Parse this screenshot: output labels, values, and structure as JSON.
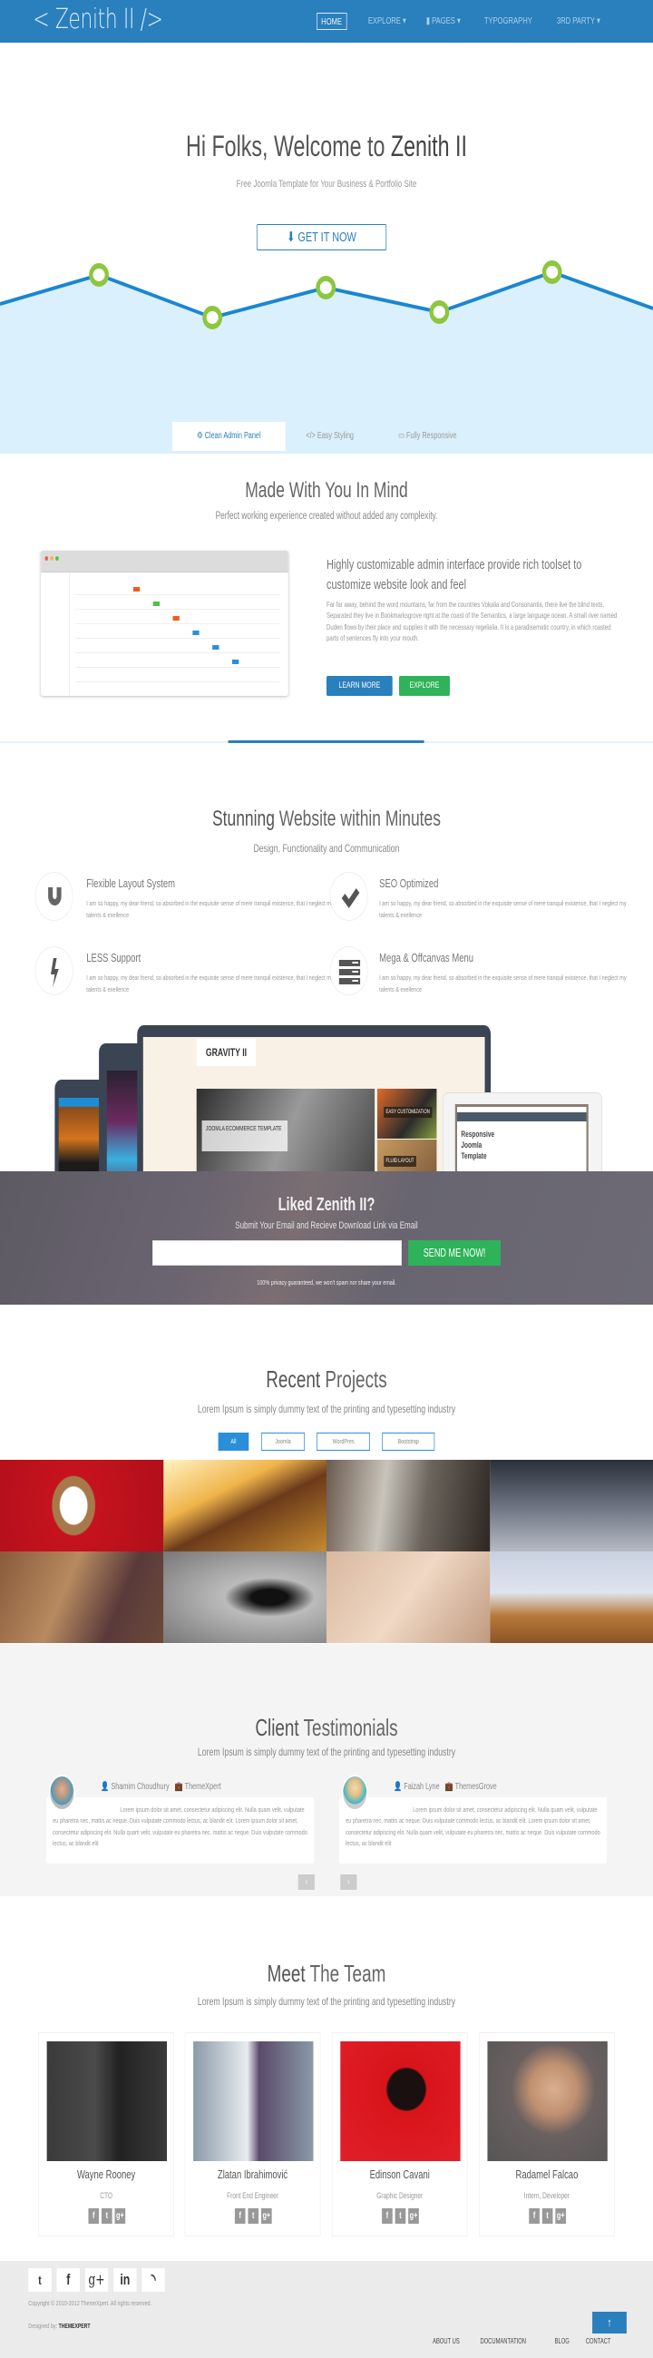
{
  "nav": {
    "logo": "< Zenith II />",
    "items": [
      {
        "label": "HOME",
        "active": true
      },
      {
        "label": "EXPLORE",
        "icon": "chevron-down-icon"
      },
      {
        "label": "PAGES",
        "icon": "file-icon"
      },
      {
        "label": "TYPOGRAPHY"
      },
      {
        "label": "3RD PARTY",
        "icon": "chevron-down-icon"
      }
    ],
    "bg_color": "#2a7fbd"
  },
  "hero": {
    "title_light": "Hi Folks, Welcome to ",
    "title_bold": "Zenith II",
    "subtitle": "Free Joomla Template for Your Business & Portfolio Site",
    "cta": "GET IT NOW",
    "cta_icon": "download-icon",
    "tabs": [
      {
        "label": "Clean Admin Panel",
        "icon": "cogs-icon",
        "active": true
      },
      {
        "label": "Easy Styling",
        "icon": "code-icon"
      },
      {
        "label": "Fully Responsive",
        "icon": "desktop-icon"
      }
    ],
    "accent": "#2a7fbd",
    "point_color": "#8dc63f"
  },
  "admin": {
    "title": "Made With You In Mind",
    "subtitle": "Perfect working experience created without added any complexity.",
    "heading": "Highly customizable admin interface provide rich toolset to customize website look and feel",
    "paragraph": "Far far away, behind the word mountains, far from the countries Vokalia and Consonantia, there live the blind texts. Separated they live in Bookmarksgrove right at the coast of the Semantics, a large language ocean. A small river named Duden flows by their place and supplies it with the necessary regelialia. It is a paradisematic country, in which roasted parts of sentences fly into your mouth.",
    "learn_more": "LEARN MORE",
    "explore": "EXPLORE"
  },
  "features": {
    "title_bold": "Stunning",
    "title_light": " Website within Minutes",
    "subtitle": "Design, Functionality and Communication",
    "items": [
      {
        "title": "Flexible Layout System",
        "icon": "magnet-icon",
        "text": "I am so happy, my dear friend, so absorbed in the exquisite sense of mere tranquil existence, that I neglect my talents & exellence"
      },
      {
        "title": "SEO Optimized",
        "icon": "check-icon",
        "text": "I am so happy, my dear friend, so absorbed in the exquisite sense of mere tranquil existence, that I neglect my talents & exellence"
      },
      {
        "title": "LESS Support",
        "icon": "bolt-icon",
        "text": "I am so happy, my dear friend, so absorbed in the exquisite sense of mere tranquil existence, that I neglect my talents & exellence"
      },
      {
        "title": "Mega & Offcanvas Menu",
        "icon": "server-icon",
        "text": "I am so happy, my dear friend, so absorbed in the exquisite sense of mere tranquil existence, that I neglect my talents & exellence"
      }
    ]
  },
  "devices": {
    "brand": "GRAVITY II",
    "slide_caption": "JOOMLA ECOMMERCE TEMPLATE",
    "badge1": "EASY CUSTOMIZATION",
    "badge2": "FLUID LAYOUT",
    "tablet_text": "Responsive Joomla Template"
  },
  "newsletter": {
    "title": "Liked Zenith II?",
    "subtitle": "Submit Your Email and Recieve Download Link via Email",
    "email_value": "",
    "button": "SEND ME NOW!",
    "privacy": "100% privacy guaranteed, we won't spam nor share your email."
  },
  "projects": {
    "title_bold": "Recent",
    "title_light": " Projects",
    "subtitle": "Lorem Ipsum is simply dummy text of the printing and typesetting industry",
    "filters": [
      {
        "label": "All",
        "active": true
      },
      {
        "label": "Joomla"
      },
      {
        "label": "WordPres"
      },
      {
        "label": "Bootstrap"
      }
    ],
    "tiles": [
      "coffee-cup",
      "girl-sunset",
      "street-bicycle",
      "smartphone",
      "coffee-macarons",
      "sunglasses",
      "desk-notebooks",
      "laptop-glasses"
    ]
  },
  "testimonials": {
    "title_bold": "Client",
    "title_light": " Testimonials",
    "subtitle": "Lorem Ipsum is simply dummy text of the printing and typesetting industry",
    "items": [
      {
        "name": "Shamim Choudhury",
        "company": "ThemeXpert",
        "text": "Lorem ipsum dolor sit amet, consectetur adipiscing elit. Nulla quam velit, vulputate eu pharetra nec, mattis ac neque. Duis vulputate commodo lectus, ac blandit elit. Lorem ipsum dolor sit amet, consectetur adipiscing elit. Nulla quam velit, vulputate eu pharetra nec, mattis ac neque. Duis vulputate commodo lectus, ac blandit elit"
      },
      {
        "name": "Faizah Lyne",
        "company": "ThemesGrove",
        "text": "Lorem ipsum dolor sit amet, consectetur adipiscing elit. Nulla quam velit, vulputate eu pharetra nec, mattis ac neque. Duis vulputate commodo lectus, ac blandit elit. Lorem ipsum dolor sit amet, consectetur adipiscing elit. Nulla quam velit, vulputate eu pharetra nec, mattis ac neque. Duis vulputate commodo lectus, ac blandit elit"
      }
    ],
    "prev": "‹",
    "next": "›"
  },
  "team": {
    "title_bold": "Meet",
    "title_light": " The Team",
    "subtitle": "Lorem Ipsum is simply dummy text of the printing and typesetting industry",
    "members": [
      {
        "name": "Wayne Rooney",
        "role": "CTO"
      },
      {
        "name": "Zlatan Ibrahimović",
        "role": "Front End Engineer"
      },
      {
        "name": "Edinson Cavani",
        "role": "Graphic Designer"
      },
      {
        "name": "Radamel Falcao",
        "role": "Intern, Developer"
      }
    ],
    "social": [
      "f",
      "t",
      "g+"
    ]
  },
  "footer": {
    "social": [
      {
        "icon": "twitter-icon",
        "glyph": "🐦"
      },
      {
        "icon": "facebook-icon",
        "glyph": "f"
      },
      {
        "icon": "google-plus-icon",
        "glyph": "g+"
      },
      {
        "icon": "linkedin-icon",
        "glyph": "in"
      },
      {
        "icon": "rss-icon",
        "glyph": "≈"
      }
    ],
    "copyright": "Copyright © 2010-2012 ThemeXpert. All rights reserved.",
    "designed_by": "Designed by: ",
    "designer": "THEMEXPERT",
    "to_top": "↑",
    "links": [
      "ABOUT US",
      "DOCUMANTATION",
      "BLOG",
      "CONTACT"
    ]
  }
}
